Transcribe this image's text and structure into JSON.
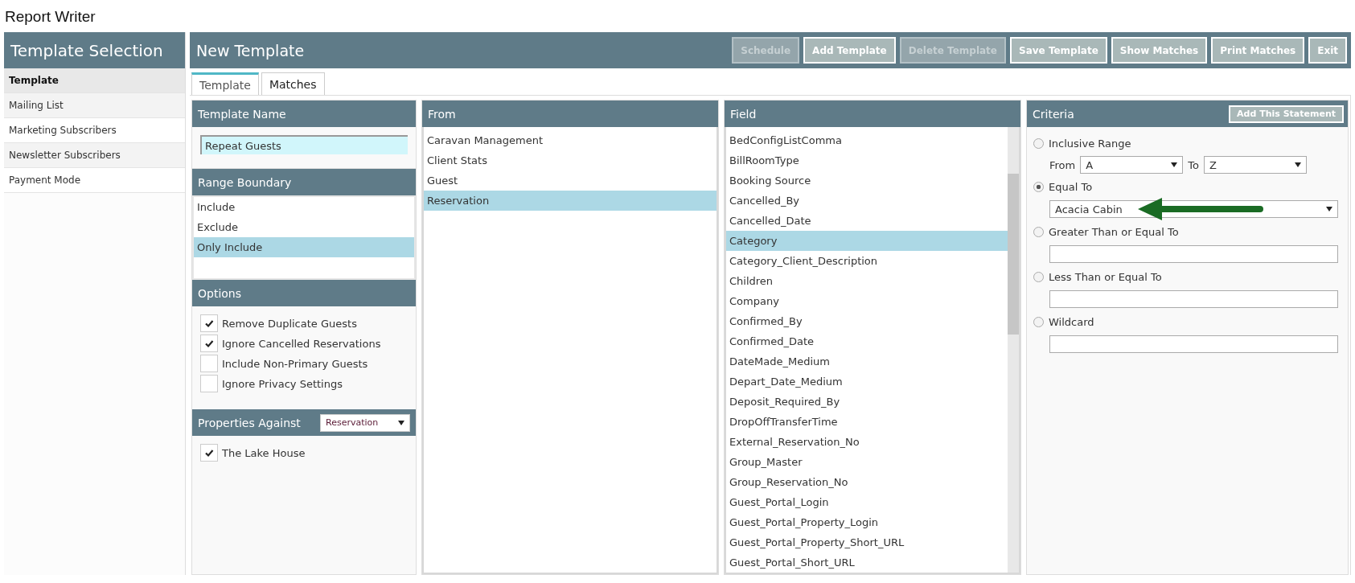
{
  "app_title": "Report Writer",
  "sidebar": {
    "title": "Template Selection",
    "items": [
      {
        "label": "Template",
        "selected": true
      },
      {
        "label": "Mailing List",
        "selected": false
      },
      {
        "label": "Marketing Subscribers",
        "selected": false
      },
      {
        "label": "Newsletter Subscribers",
        "selected": false
      },
      {
        "label": "Payment Mode",
        "selected": false
      }
    ]
  },
  "header": {
    "title": "New Template",
    "buttons": [
      {
        "label": "Schedule",
        "disabled": true
      },
      {
        "label": "Add Template",
        "disabled": false
      },
      {
        "label": "Delete Template",
        "disabled": true
      },
      {
        "label": "Save Template",
        "disabled": false
      },
      {
        "label": "Show Matches",
        "disabled": false
      },
      {
        "label": "Print Matches",
        "disabled": false
      },
      {
        "label": "Exit",
        "disabled": false
      }
    ]
  },
  "tabs": [
    {
      "label": "Template",
      "selected": true
    },
    {
      "label": "Matches",
      "selected": false
    }
  ],
  "template_name": {
    "title": "Template Name",
    "value": "Repeat Guests"
  },
  "range_boundary": {
    "title": "Range Boundary",
    "items": [
      {
        "label": "Include",
        "selected": false
      },
      {
        "label": "Exclude",
        "selected": false
      },
      {
        "label": "Only Include",
        "selected": true
      }
    ]
  },
  "options": {
    "title": "Options",
    "items": [
      {
        "label": "Remove Duplicate Guests",
        "checked": true
      },
      {
        "label": "Ignore Cancelled Reservations",
        "checked": true
      },
      {
        "label": "Include Non-Primary Guests",
        "checked": false
      },
      {
        "label": "Ignore Privacy Settings",
        "checked": false
      }
    ]
  },
  "properties": {
    "title": "Properties Against",
    "select": "Reservation",
    "items": [
      {
        "label": "The Lake House",
        "checked": true
      }
    ]
  },
  "from": {
    "title": "From",
    "items": [
      {
        "label": "Caravan Management",
        "selected": false
      },
      {
        "label": "Client Stats",
        "selected": false
      },
      {
        "label": "Guest",
        "selected": false
      },
      {
        "label": "Reservation",
        "selected": true
      }
    ]
  },
  "field": {
    "title": "Field",
    "items": [
      {
        "label": "BedConfigListComma",
        "selected": false
      },
      {
        "label": "BillRoomType",
        "selected": false
      },
      {
        "label": "Booking Source",
        "selected": false
      },
      {
        "label": "Cancelled_By",
        "selected": false
      },
      {
        "label": "Cancelled_Date",
        "selected": false
      },
      {
        "label": "Category",
        "selected": true
      },
      {
        "label": "Category_Client_Description",
        "selected": false
      },
      {
        "label": "Children",
        "selected": false
      },
      {
        "label": "Company",
        "selected": false
      },
      {
        "label": "Confirmed_By",
        "selected": false
      },
      {
        "label": "Confirmed_Date",
        "selected": false
      },
      {
        "label": "DateMade_Medium",
        "selected": false
      },
      {
        "label": "Depart_Date_Medium",
        "selected": false
      },
      {
        "label": "Deposit_Required_By",
        "selected": false
      },
      {
        "label": "DropOffTransferTime",
        "selected": false
      },
      {
        "label": "External_Reservation_No",
        "selected": false
      },
      {
        "label": "Group_Master",
        "selected": false
      },
      {
        "label": "Group_Reservation_No",
        "selected": false
      },
      {
        "label": "Guest_Portal_Login",
        "selected": false
      },
      {
        "label": "Guest_Portal_Property_Login",
        "selected": false
      },
      {
        "label": "Guest_Portal_Property_Short_URL",
        "selected": false
      },
      {
        "label": "Guest_Portal_Short_URL",
        "selected": false
      }
    ]
  },
  "criteria": {
    "title": "Criteria",
    "button": "Add This Statement",
    "options": [
      {
        "kind": "range",
        "label": "Inclusive Range",
        "selected": false,
        "from_label": "From",
        "from": "A",
        "to_label": "To",
        "to": "Z"
      },
      {
        "kind": "select",
        "label": "Equal To",
        "selected": true,
        "value": "Acacia Cabin",
        "annotated": true
      },
      {
        "kind": "input",
        "label": "Greater Than or Equal To",
        "selected": false
      },
      {
        "kind": "input",
        "label": "Less Than or Equal To",
        "selected": false
      },
      {
        "kind": "input",
        "label": "Wildcard",
        "selected": false
      }
    ]
  }
}
